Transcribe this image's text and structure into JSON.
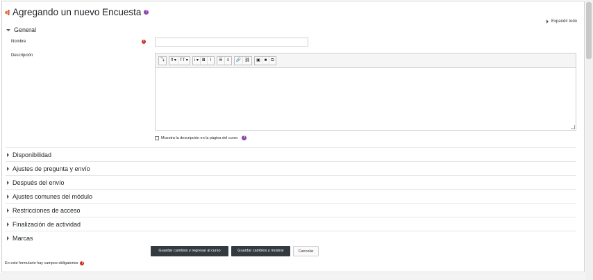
{
  "page": {
    "title": "Agregando un nuevo Encuesta",
    "expand_all": "Expandir todo"
  },
  "sections": {
    "general": "General",
    "collapsed": [
      "Disponibilidad",
      "Ajustes de pregunta y envío",
      "Después del envío",
      "Ajustes comunes del módulo",
      "Restricciones de acceso",
      "Finalización de actividad",
      "Marcas"
    ]
  },
  "form": {
    "name_label": "Nombre",
    "name_value": "",
    "description_label": "Descripción",
    "show_description_label": "Muestra la descripción en la página del curso",
    "required_icon": "!",
    "help_icon": "?"
  },
  "toolbar": {
    "toggle": "⤵",
    "font": "ff ▾",
    "size": "TT ▾",
    "info": "i ▾",
    "bold": "B",
    "italic": "I",
    "bullet": "☰",
    "numbered": "≡",
    "link": "🔗",
    "unlink": "⛓",
    "image": "▣",
    "media": "■",
    "manage": "⧉"
  },
  "buttons": {
    "save_return": "Guardar cambios y regresar al curso",
    "save_show": "Guardar cambios y mostrar",
    "cancel": "Cancelar"
  },
  "footer": {
    "required_note": "En este formulario hay campos obligatorios"
  },
  "colors": {
    "required": "#ca3120",
    "help": "#8e44ad",
    "primary_button": "#333b41",
    "module_icon": "#e8732c"
  }
}
